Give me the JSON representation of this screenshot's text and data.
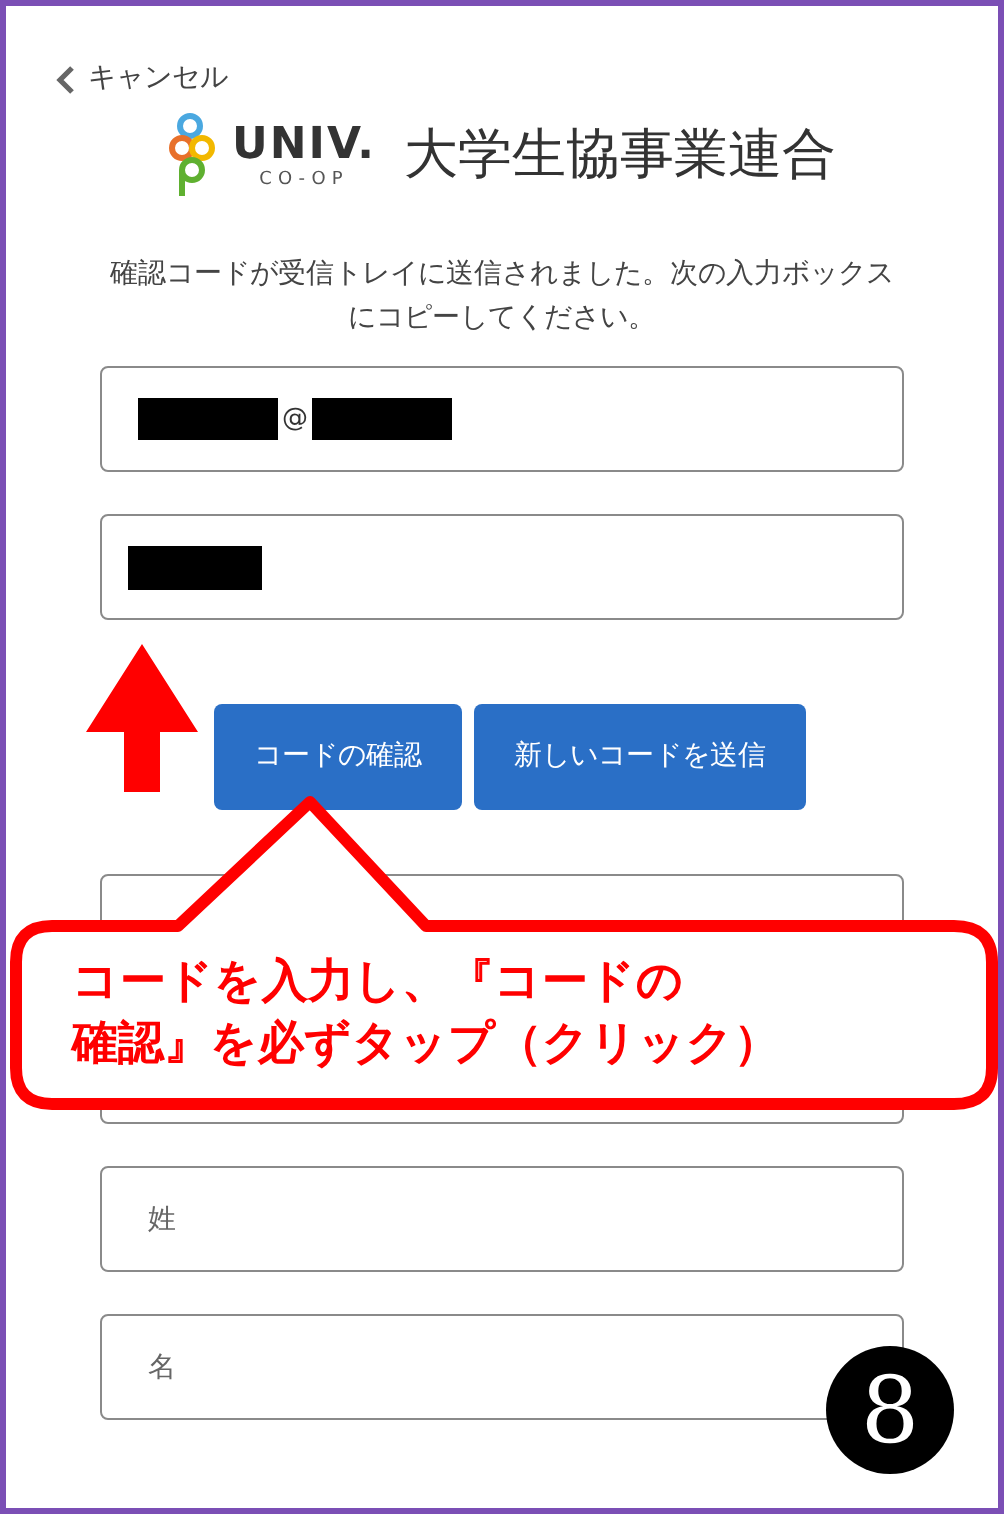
{
  "cancel_link": {
    "label": "キャンセル"
  },
  "logo": {
    "mark": "UNIV.",
    "sub": "CO-OP",
    "name": "大学生協事業連合"
  },
  "message": "確認コードが受信トレイに送信されました。次の入力ボックスにコピーしてください。",
  "fields": [
    {
      "kind": "email",
      "value": "@",
      "redacted": true
    },
    {
      "kind": "code",
      "redacted": true
    }
  ],
  "buttons": [
    {
      "label": "コードの確認"
    },
    {
      "label": "新しいコードを送信"
    }
  ],
  "more_fields": [
    {
      "kind": "covered"
    },
    {
      "kind": "text",
      "placeholder": "姓"
    },
    {
      "kind": "text",
      "placeholder": "名"
    }
  ],
  "callout": {
    "lines": [
      "コードを入力し、『コードの",
      "確認』を必ずタップ（クリック）"
    ]
  },
  "step_badge": {
    "label": "8"
  }
}
